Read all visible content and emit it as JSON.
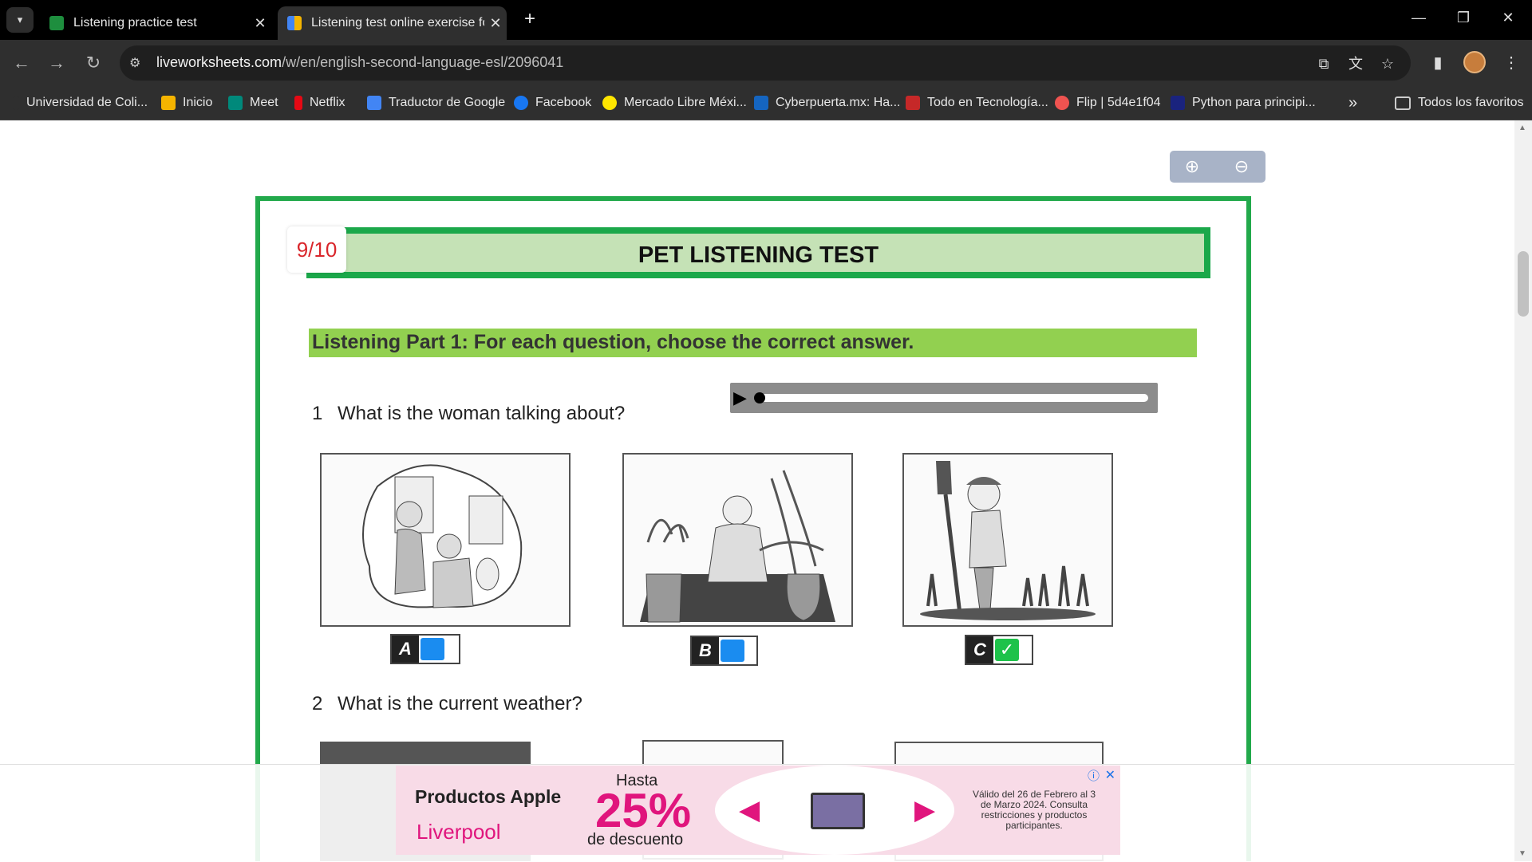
{
  "tabs": [
    {
      "title": "Listening practice test",
      "favicon_color": "#1e8e3e",
      "active": false
    },
    {
      "title": "Listening test online exercise fo",
      "favicon_color": "#f4b400",
      "active": true
    }
  ],
  "new_tab": "+",
  "window_controls": {
    "minimize": "—",
    "restore": "❐",
    "close": "✕"
  },
  "url": {
    "host": "liveworksheets.com",
    "path": "/w/en/english-second-language-esl/2096041"
  },
  "bookmarks": [
    {
      "label": "Universidad de Coli...",
      "icon": "none",
      "color": "#2f2f2f"
    },
    {
      "label": "Inicio",
      "icon": "classroom-icon",
      "color": "#f5b400"
    },
    {
      "label": "Meet",
      "icon": "meet-icon",
      "color": "#00897b"
    },
    {
      "label": "Netflix",
      "icon": "netflix-icon",
      "color": "#e50914"
    },
    {
      "label": "Traductor de Google",
      "icon": "translate-icon",
      "color": "#4285f4"
    },
    {
      "label": "Facebook",
      "icon": "facebook-icon",
      "color": "#1877f2"
    },
    {
      "label": "Mercado Libre Méxi...",
      "icon": "mercadolibre-icon",
      "color": "#ffe600"
    },
    {
      "label": "Cyberpuerta.mx: Ha...",
      "icon": "cyberpuerta-icon",
      "color": "#1565c0"
    },
    {
      "label": "Todo en Tecnología...",
      "icon": "tech-icon",
      "color": "#c62828"
    },
    {
      "label": "Flip | 5d4e1f04",
      "icon": "flip-icon",
      "color": "#ef5350"
    },
    {
      "label": "Python para principi...",
      "icon": "python-icon",
      "color": "#1a237e"
    }
  ],
  "bookmarks_overflow": "»",
  "all_bookmarks": "Todos los favoritos",
  "worksheet": {
    "score": "9/10",
    "title": "PET LISTENING TEST",
    "part": "Listening Part 1: For each question, choose the correct answer.",
    "questions": [
      {
        "number": "1",
        "text": "What is the woman talking about?",
        "options": [
          {
            "letter": "A",
            "state": "unselected"
          },
          {
            "letter": "B",
            "state": "unselected"
          },
          {
            "letter": "C",
            "state": "correct",
            "mark": "✓"
          }
        ]
      },
      {
        "number": "2",
        "text": "What is the current weather?"
      }
    ]
  },
  "ad": {
    "brand": "Productos Apple",
    "store": "Liverpool",
    "hasta": "Hasta",
    "percent": "25%",
    "descuento": "de descuento",
    "legal": "Válido del 26 de Febrero al 3 de Marzo 2024. Consulta restricciones y productos participantes.",
    "prev": "◀",
    "next": "▶",
    "info": "ⓘ",
    "close": "✕"
  },
  "colors": {
    "accent_green": "#1ba84a",
    "part_green": "#92d050",
    "score_red": "#d9262b",
    "radio_blue": "#1a8cf0",
    "correct_green": "#1ec24a",
    "ad_pink": "#e0157d"
  }
}
